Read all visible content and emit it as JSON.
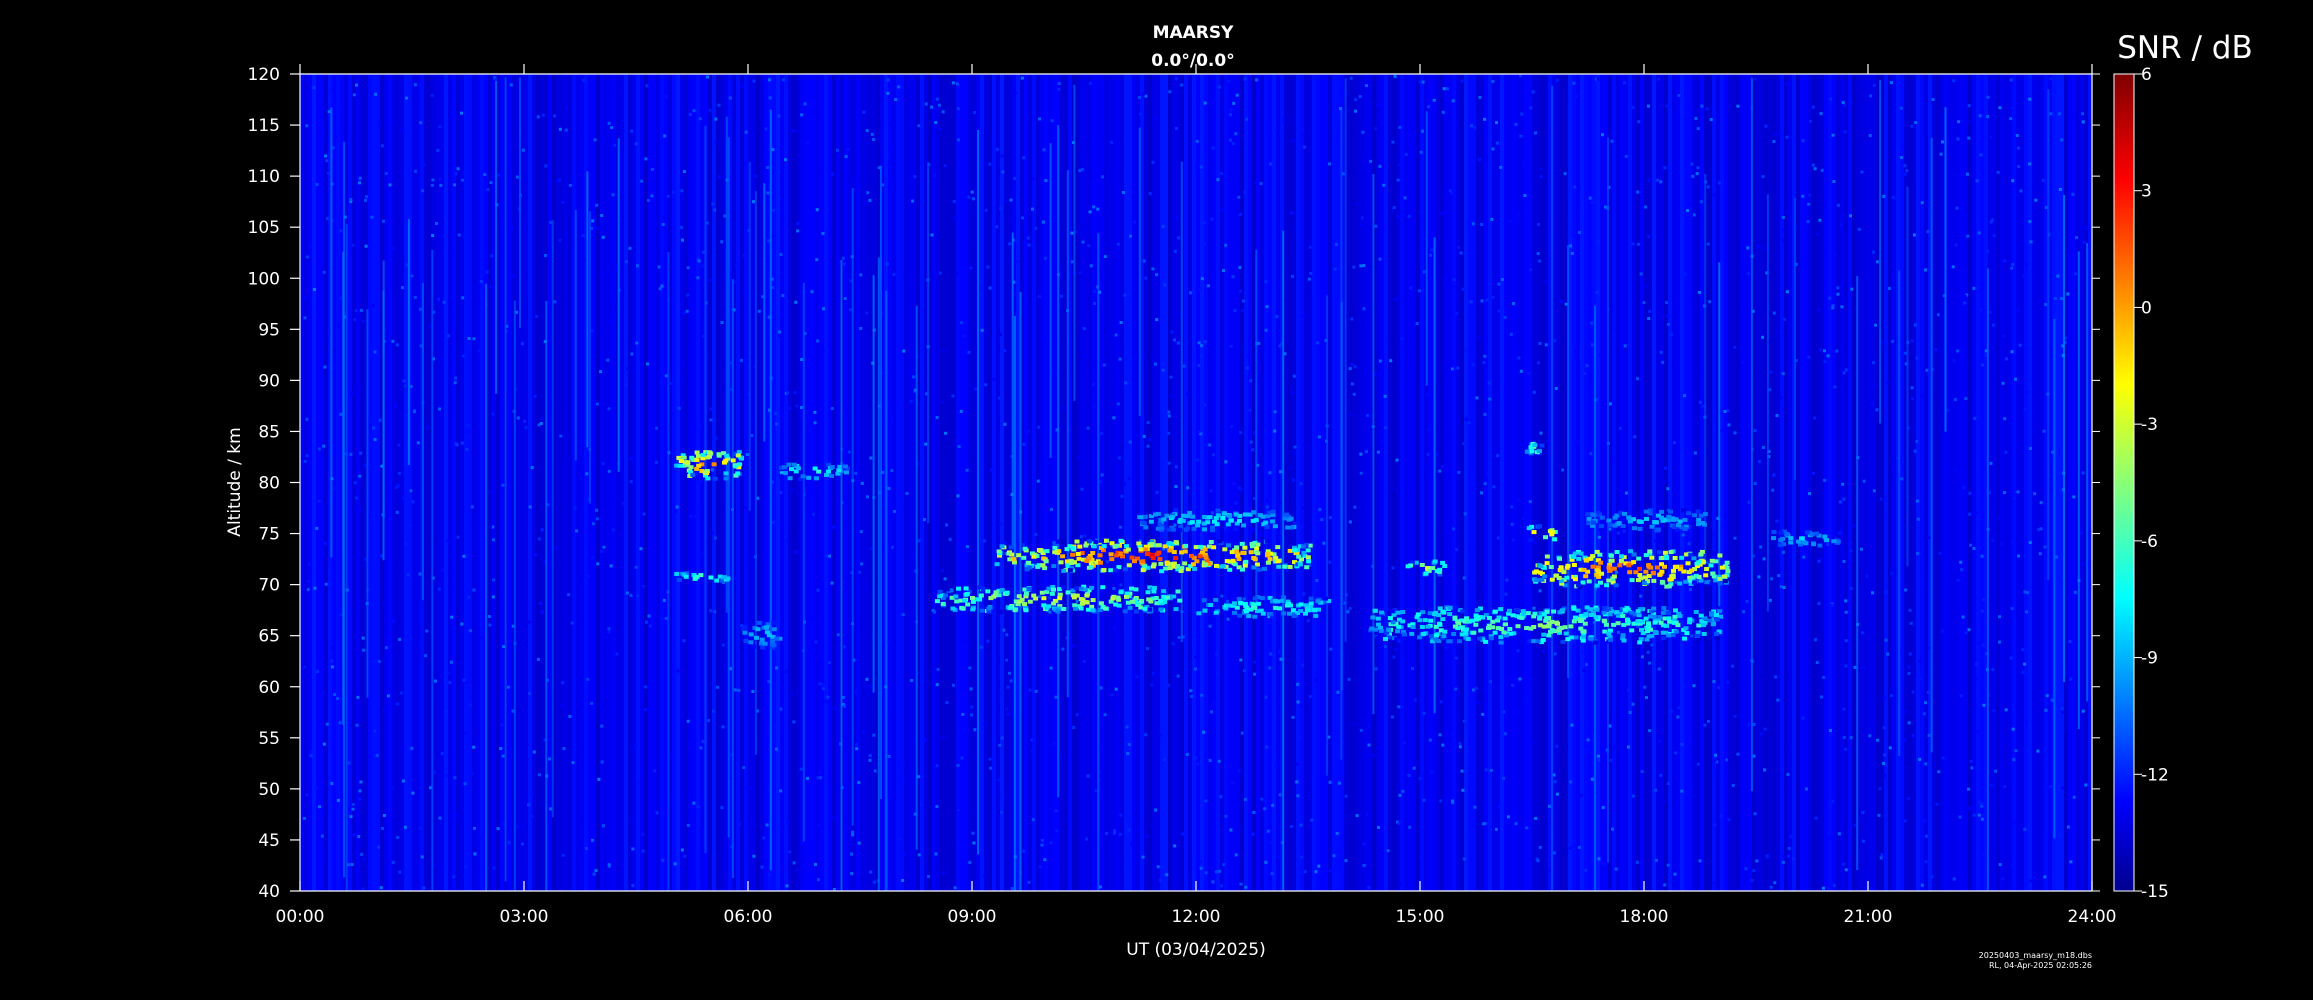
{
  "chart_data": {
    "type": "heatmap",
    "title": "MAARSY",
    "subtitle": "0.0°/0.0°",
    "xlabel": "UT (03/04/2025)",
    "ylabel": "Altitude / km",
    "colorbar_label": "SNR / dB",
    "x_ticks": [
      "00:00",
      "03:00",
      "06:00",
      "09:00",
      "12:00",
      "15:00",
      "18:00",
      "21:00",
      "24:00"
    ],
    "xlim_hours": [
      0,
      24
    ],
    "y_ticks": [
      40,
      45,
      50,
      55,
      60,
      65,
      70,
      75,
      80,
      85,
      90,
      95,
      100,
      105,
      110,
      115,
      120
    ],
    "ylim": [
      40,
      120
    ],
    "colorbar_ticks": [
      6,
      3,
      0,
      -3,
      -6,
      -9,
      -12,
      -15
    ],
    "clim": [
      -15,
      6
    ],
    "colormap": [
      "#00008f",
      "#0000ff",
      "#00ffff",
      "#ffff00",
      "#ff0000",
      "#800000"
    ],
    "background_color": "#000000",
    "echo_layers": [
      {
        "t_start": 5.0,
        "t_end": 5.9,
        "alt_low": 80.5,
        "alt_high": 83.5,
        "snr_peak": 2
      },
      {
        "t_start": 6.4,
        "t_end": 7.3,
        "alt_low": 80.5,
        "alt_high": 82.0,
        "snr_peak": -6
      },
      {
        "t_start": 5.0,
        "t_end": 5.8,
        "alt_low": 70.5,
        "alt_high": 71.5,
        "snr_peak": -5
      },
      {
        "t_start": 5.9,
        "t_end": 6.4,
        "alt_low": 64.0,
        "alt_high": 66.5,
        "snr_peak": -8
      },
      {
        "t_start": 8.5,
        "t_end": 11.8,
        "alt_low": 67.5,
        "alt_high": 70.0,
        "snr_peak": -2
      },
      {
        "t_start": 9.3,
        "t_end": 13.5,
        "alt_low": 71.5,
        "alt_high": 74.5,
        "snr_peak": 4
      },
      {
        "t_start": 11.2,
        "t_end": 13.3,
        "alt_low": 75.5,
        "alt_high": 77.5,
        "snr_peak": -7
      },
      {
        "t_start": 12.0,
        "t_end": 13.8,
        "alt_low": 67.0,
        "alt_high": 69.0,
        "snr_peak": -6
      },
      {
        "t_start": 14.3,
        "t_end": 19.0,
        "alt_low": 64.5,
        "alt_high": 68.0,
        "snr_peak": -4
      },
      {
        "t_start": 16.5,
        "t_end": 19.1,
        "alt_low": 70.0,
        "alt_high": 73.5,
        "snr_peak": 3
      },
      {
        "t_start": 16.4,
        "t_end": 16.8,
        "alt_low": 74.5,
        "alt_high": 76.0,
        "snr_peak": 2
      },
      {
        "t_start": 17.2,
        "t_end": 18.8,
        "alt_low": 75.5,
        "alt_high": 77.5,
        "snr_peak": -8
      },
      {
        "t_start": 14.8,
        "t_end": 15.3,
        "alt_low": 71.0,
        "alt_high": 72.5,
        "snr_peak": -2
      },
      {
        "t_start": 16.4,
        "t_end": 16.6,
        "alt_low": 83.0,
        "alt_high": 84.0,
        "snr_peak": -3
      },
      {
        "t_start": 19.6,
        "t_end": 20.6,
        "alt_low": 74.0,
        "alt_high": 75.5,
        "snr_peak": -8
      }
    ],
    "footer_line1": "20250403_maarsy_m18.dbs",
    "footer_line2": "RL, 04-Apr-2025 02:05:26"
  }
}
